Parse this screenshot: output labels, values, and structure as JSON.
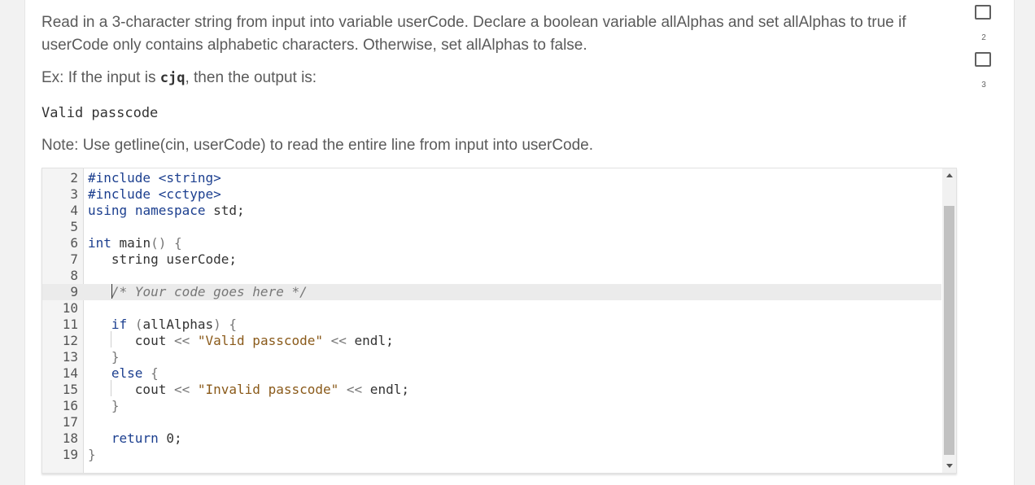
{
  "prompt": {
    "text": "Read in a 3-character string from input into variable userCode. Declare a boolean variable allAlphas and set allAlphas to true if userCode only contains alphabetic characters. Otherwise, set allAlphas to false.",
    "example_prefix": "Ex: If the input is ",
    "example_input": "cjq",
    "example_suffix": ", then the output is:",
    "expected_output": "Valid passcode",
    "note": "Note: Use getline(cin, userCode) to read the entire line from input into userCode."
  },
  "editor": {
    "lines": [
      {
        "n": "2",
        "tokens": [
          {
            "c": "pp",
            "t": "#include <string>"
          }
        ]
      },
      {
        "n": "3",
        "tokens": [
          {
            "c": "pp",
            "t": "#include <cctype>"
          }
        ]
      },
      {
        "n": "4",
        "tokens": [
          {
            "c": "kw",
            "t": "using"
          },
          {
            "c": "plain",
            "t": " "
          },
          {
            "c": "ty",
            "t": "namespace"
          },
          {
            "c": "plain",
            "t": " std;"
          }
        ]
      },
      {
        "n": "5",
        "tokens": []
      },
      {
        "n": "6",
        "tokens": [
          {
            "c": "ty",
            "t": "int"
          },
          {
            "c": "plain",
            "t": " main"
          },
          {
            "c": "punct",
            "t": "() {"
          }
        ]
      },
      {
        "n": "7",
        "tokens": [
          {
            "c": "plain",
            "t": "   string userCode;"
          }
        ]
      },
      {
        "n": "8",
        "tokens": []
      },
      {
        "n": "9",
        "tokens": [
          {
            "c": "plain",
            "t": "   "
          },
          {
            "c": "cm",
            "t": "/* Your code goes here */"
          }
        ]
      },
      {
        "n": "10",
        "tokens": []
      },
      {
        "n": "11",
        "tokens": [
          {
            "c": "plain",
            "t": "   "
          },
          {
            "c": "kw",
            "t": "if"
          },
          {
            "c": "plain",
            "t": " "
          },
          {
            "c": "punct",
            "t": "("
          },
          {
            "c": "plain",
            "t": "allAlphas"
          },
          {
            "c": "punct",
            "t": ") {"
          }
        ]
      },
      {
        "n": "12",
        "tokens": [
          {
            "c": "plain",
            "t": "      cout "
          },
          {
            "c": "punct",
            "t": "<<"
          },
          {
            "c": "plain",
            "t": " "
          },
          {
            "c": "str",
            "t": "\"Valid passcode\""
          },
          {
            "c": "plain",
            "t": " "
          },
          {
            "c": "punct",
            "t": "<<"
          },
          {
            "c": "plain",
            "t": " endl;"
          }
        ]
      },
      {
        "n": "13",
        "tokens": [
          {
            "c": "plain",
            "t": "   "
          },
          {
            "c": "punct",
            "t": "}"
          }
        ]
      },
      {
        "n": "14",
        "tokens": [
          {
            "c": "plain",
            "t": "   "
          },
          {
            "c": "kw",
            "t": "else"
          },
          {
            "c": "plain",
            "t": " "
          },
          {
            "c": "punct",
            "t": "{"
          }
        ]
      },
      {
        "n": "15",
        "tokens": [
          {
            "c": "plain",
            "t": "      cout "
          },
          {
            "c": "punct",
            "t": "<<"
          },
          {
            "c": "plain",
            "t": " "
          },
          {
            "c": "str",
            "t": "\"Invalid passcode\""
          },
          {
            "c": "plain",
            "t": " "
          },
          {
            "c": "punct",
            "t": "<<"
          },
          {
            "c": "plain",
            "t": " endl;"
          }
        ]
      },
      {
        "n": "16",
        "tokens": [
          {
            "c": "plain",
            "t": "   "
          },
          {
            "c": "punct",
            "t": "}"
          }
        ]
      },
      {
        "n": "17",
        "tokens": []
      },
      {
        "n": "18",
        "tokens": [
          {
            "c": "plain",
            "t": "   "
          },
          {
            "c": "kw",
            "t": "return"
          },
          {
            "c": "plain",
            "t": " 0;"
          }
        ]
      },
      {
        "n": "19",
        "tokens": [
          {
            "c": "punct",
            "t": "}"
          }
        ]
      }
    ],
    "active_line": "9"
  },
  "side": {
    "items": [
      {
        "label": "2"
      },
      {
        "label": "3"
      }
    ]
  },
  "colors": {
    "keyword": "#1c3f8f",
    "string": "#8a5a1a",
    "comment": "#777777"
  }
}
